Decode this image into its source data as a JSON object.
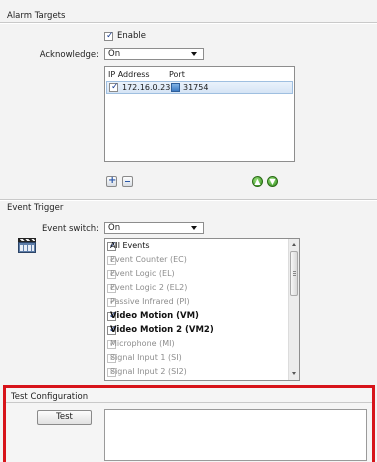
{
  "alarm_targets": {
    "title": "Alarm Targets",
    "enable_label": "Enable",
    "enable_checked": true,
    "acknowledge_label": "Acknowledge:",
    "acknowledge_value": "On",
    "list_header_ip": "IP Address",
    "list_header_port": "Port",
    "rows": [
      {
        "checked": true,
        "ip": "172.16.0.23",
        "port": "31754"
      }
    ]
  },
  "event_trigger": {
    "title": "Event Trigger",
    "event_switch_label": "Event switch:",
    "event_switch_value": "On",
    "events": [
      {
        "label": "All Events",
        "checked": true,
        "state": "on"
      },
      {
        "label": "Event Counter (EC)",
        "checked": true,
        "state": "disabled"
      },
      {
        "label": "Event Logic (EL)",
        "checked": true,
        "state": "disabled"
      },
      {
        "label": "Event Logic 2 (EL2)",
        "checked": true,
        "state": "disabled"
      },
      {
        "label": "Passive Infrared (PI)",
        "checked": true,
        "state": "disabled"
      },
      {
        "label": "Video Motion (VM)",
        "checked": true,
        "state": "bold"
      },
      {
        "label": "Video Motion 2 (VM2)",
        "checked": true,
        "state": "bold"
      },
      {
        "label": "Microphone (MI)",
        "checked": true,
        "state": "disabled"
      },
      {
        "label": "Signal Input 1 (SI)",
        "checked": true,
        "state": "disabled"
      },
      {
        "label": "Signal Input 2 (SI2)",
        "checked": true,
        "state": "disabled"
      }
    ]
  },
  "test_configuration": {
    "title": "Test Configuration",
    "test_button": "Test",
    "highlight_color": "#d7141a"
  }
}
